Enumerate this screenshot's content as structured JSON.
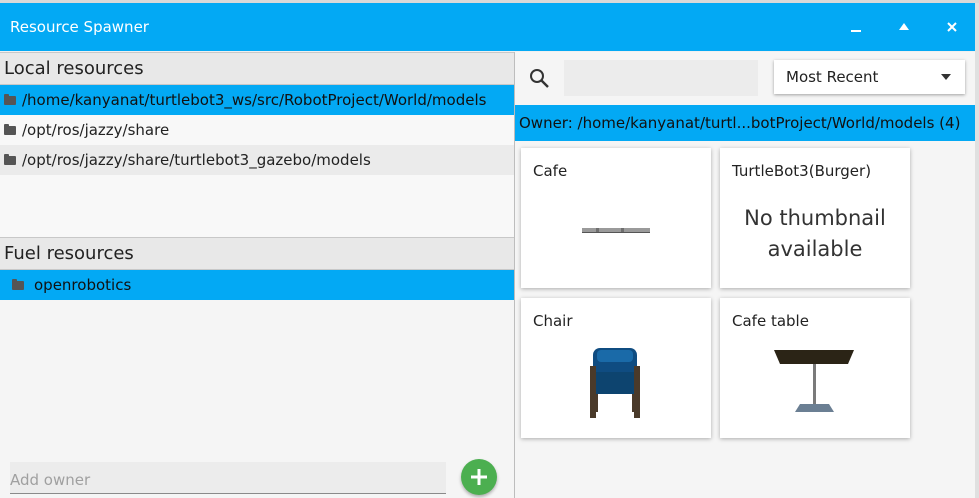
{
  "window": {
    "title": "Resource Spawner"
  },
  "left": {
    "local_header": "Local resources",
    "local_items": [
      "/home/kanyanat/turtlebot3_ws/src/RobotProject/World/models",
      "/opt/ros/jazzy/share",
      "/opt/ros/jazzy/share/turtlebot3_gazebo/models"
    ],
    "fuel_header": "Fuel resources",
    "fuel_items": [
      "openrobotics"
    ],
    "add_owner_placeholder": "Add owner"
  },
  "right": {
    "search_value": "",
    "sort_value": "Most Recent",
    "owner_label": "Owner: /home/kanyanat/turtl...botProject/World/models (4)",
    "cards": [
      {
        "name": "Cafe"
      },
      {
        "name": "TurtleBot3(Burger)",
        "thumbnail_text": "No thumbnail available"
      },
      {
        "name": "Chair"
      },
      {
        "name": "Cafe table"
      }
    ]
  },
  "colors": {
    "accent": "#03a9f4",
    "add_button": "#4caf50"
  },
  "icons": [
    "minimize-icon",
    "maximize-icon",
    "close-icon",
    "folder-icon",
    "search-icon",
    "caret-down-icon",
    "plus-icon"
  ]
}
